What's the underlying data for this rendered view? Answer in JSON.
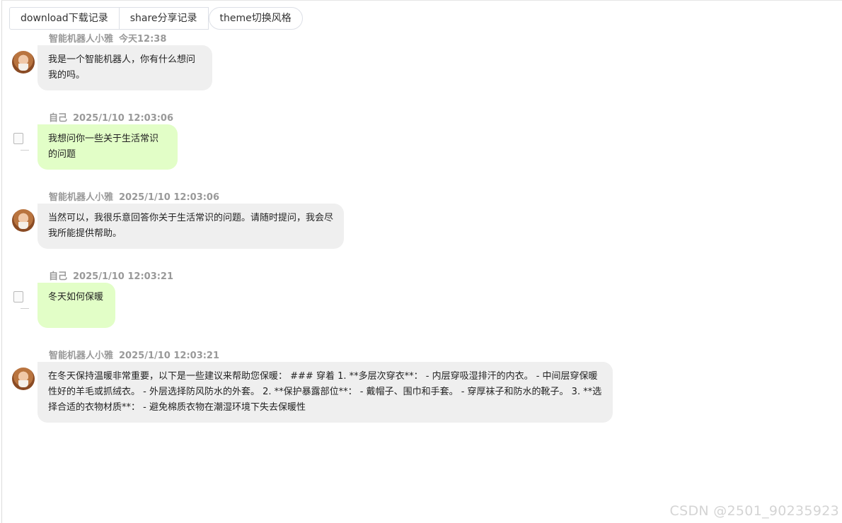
{
  "toolbar": {
    "download_label": "download下载记录",
    "share_label": "share分享记录",
    "theme_label": "theme切换风格"
  },
  "messages": [
    {
      "sender": "智能机器人小雅",
      "time": "今天12:38",
      "text": "我是一个智能机器人，你有什么想问我的吗。",
      "role": "bot"
    },
    {
      "sender": "自己",
      "time": "2025/1/10 12:03:06",
      "text": "我想问你一些关于生活常识的问题",
      "role": "user"
    },
    {
      "sender": "智能机器人小雅",
      "time": "2025/1/10 12:03:06",
      "text": "当然可以，我很乐意回答你关于生活常识的问题。请随时提问，我会尽我所能提供帮助。",
      "role": "bot"
    },
    {
      "sender": "自己",
      "time": "2025/1/10 12:03:21",
      "text": "冬天如何保暖",
      "role": "user"
    },
    {
      "sender": "智能机器人小雅",
      "time": "2025/1/10 12:03:21",
      "text": "在冬天保持温暖非常重要，以下是一些建议来帮助您保暖： ### 穿着 1. **多层次穿衣**： - 内层穿吸湿排汗的内衣。 - 中间层穿保暖性好的羊毛或抓绒衣。 - 外层选择防风防水的外套。 2. **保护暴露部位**： - 戴帽子、围巾和手套。 - 穿厚袜子和防水的靴子。 3. **选择合适的衣物材质**： - 避免棉质衣物在潮湿环境下失去保暖性",
      "role": "bot"
    }
  ],
  "colors": {
    "bot_bubble": "#efefef",
    "user_bubble": "#e2fec7",
    "meta_text": "#999999"
  },
  "watermark": "CSDN @2501_90235923"
}
